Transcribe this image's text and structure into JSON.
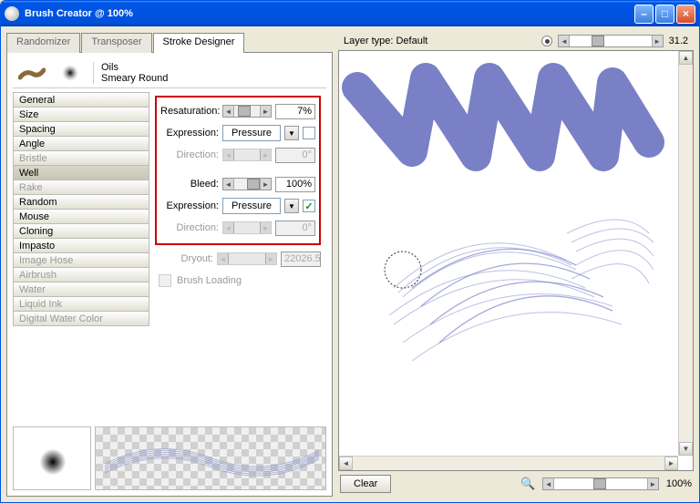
{
  "window": {
    "title": "Brush Creator @ 100%"
  },
  "tabs": [
    {
      "label": "Randomizer",
      "active": false
    },
    {
      "label": "Transposer",
      "active": false
    },
    {
      "label": "Stroke Designer",
      "active": true
    }
  ],
  "brush": {
    "category": "Oils",
    "variant": "Smeary Round"
  },
  "categories": [
    {
      "label": "General",
      "disabled": false
    },
    {
      "label": "Size",
      "disabled": false
    },
    {
      "label": "Spacing",
      "disabled": false
    },
    {
      "label": "Angle",
      "disabled": false
    },
    {
      "label": "Bristle",
      "disabled": true
    },
    {
      "label": "Well",
      "disabled": false,
      "selected": true
    },
    {
      "label": "Rake",
      "disabled": true
    },
    {
      "label": "Random",
      "disabled": false
    },
    {
      "label": "Mouse",
      "disabled": false
    },
    {
      "label": "Cloning",
      "disabled": false
    },
    {
      "label": "Impasto",
      "disabled": false
    },
    {
      "label": "Image Hose",
      "disabled": true
    },
    {
      "label": "Airbrush",
      "disabled": true
    },
    {
      "label": "Water",
      "disabled": true
    },
    {
      "label": "Liquid Ink",
      "disabled": true
    },
    {
      "label": "Digital Water Color",
      "disabled": true
    }
  ],
  "settings": {
    "resaturation": {
      "label": "Resaturation:",
      "value": "7%"
    },
    "expression1": {
      "label": "Expression:",
      "value": "Pressure",
      "checked": false
    },
    "direction1": {
      "label": "Direction:",
      "value": "0°"
    },
    "bleed": {
      "label": "Bleed:",
      "value": "100%"
    },
    "expression2": {
      "label": "Expression:",
      "value": "Pressure",
      "checked": true
    },
    "direction2": {
      "label": "Direction:",
      "value": "0°"
    },
    "dryout": {
      "label": "Dryout:",
      "value": "22026.5"
    },
    "brushLoading": {
      "label": "Brush Loading"
    }
  },
  "layer": {
    "label": "Layer type: Default",
    "value": "31.2"
  },
  "footer": {
    "clear": "Clear",
    "zoom": "100%"
  }
}
